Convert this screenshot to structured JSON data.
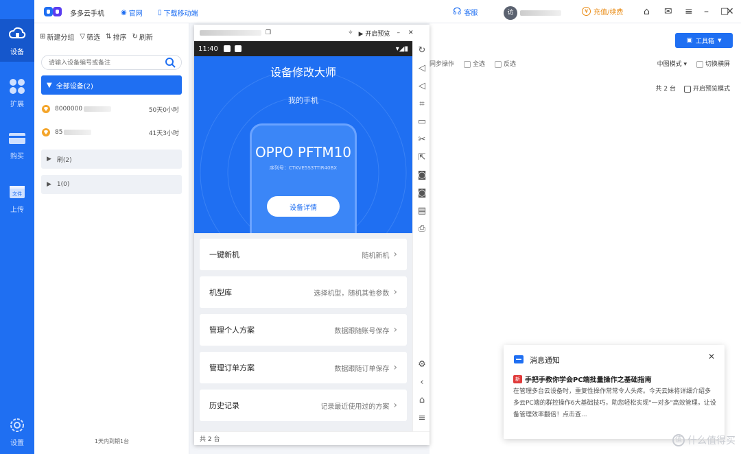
{
  "nav": [
    {
      "label": "设备",
      "icon": "cloud-device-icon"
    },
    {
      "label": "扩展",
      "icon": "apps-grid-icon"
    },
    {
      "label": "购买",
      "icon": "card-icon"
    },
    {
      "label": "上传",
      "icon": "file-upload-icon"
    },
    {
      "label": "设置",
      "icon": "gear-icon"
    }
  ],
  "titlebar": {
    "app_name": "多多云手机",
    "official": "官网",
    "download": "下载移动端",
    "service": "客服",
    "recharge": "充值/续费"
  },
  "devpanel": {
    "new_group": "新建分组",
    "filter": "筛选",
    "sort": "排序",
    "refresh": "刷新",
    "search_placeholder": "请输入设备编号或备注",
    "all_devices": "全部设备(2)",
    "devices": [
      {
        "id": "8000000",
        "time": "50天0小时"
      },
      {
        "id": "85",
        "time": "41天3小时"
      }
    ],
    "groups": [
      "刷(2)",
      "1(0)"
    ],
    "expire_note": "1天内到期1台"
  },
  "phone": {
    "clock": "11:40",
    "preview": "开启预览",
    "hero_title": "设备修改大师",
    "hero_sub": "我的手机",
    "model": "OPPO PFTM10",
    "serial": "序列号：CTKVE5S3TTIR40BX",
    "detail_button": "设备详情",
    "menu": [
      {
        "label": "一键新机",
        "desc": "随机新机"
      },
      {
        "label": "机型库",
        "desc": "选择机型，随机其他参数"
      },
      {
        "label": "管理个人方案",
        "desc": "数据跟随账号保存"
      },
      {
        "label": "管理订单方案",
        "desc": "数据跟随订单保存"
      },
      {
        "label": "历史记录",
        "desc": "记录最近使用过的方案"
      }
    ],
    "footer_count": "共 2 台"
  },
  "main": {
    "toolbox": "工具箱",
    "sync": "同步操作",
    "select_all": "全选",
    "invert": "反选",
    "mode": "中图模式",
    "switch_screen": "切换横屏",
    "count": "共 2 台",
    "preview_mode": "开启预览模式"
  },
  "notify": {
    "header": "消息通知",
    "tag": "新",
    "title": "手把手教你学会PC端批量操作之基础指南",
    "body": "在管理多台云设备时，重复性操作常常令人头疼。今天云妹将详细介绍多多云PC端的群控操作6大基础技巧，助您轻松实现\"一对多\"高效管理，让设备管理效率翻倍！点击查..."
  },
  "watermark": "什么值得买",
  "colors": {
    "accent": "#1f6ff2",
    "nav_active": "#1557cc",
    "tag": "#e03a3a"
  }
}
